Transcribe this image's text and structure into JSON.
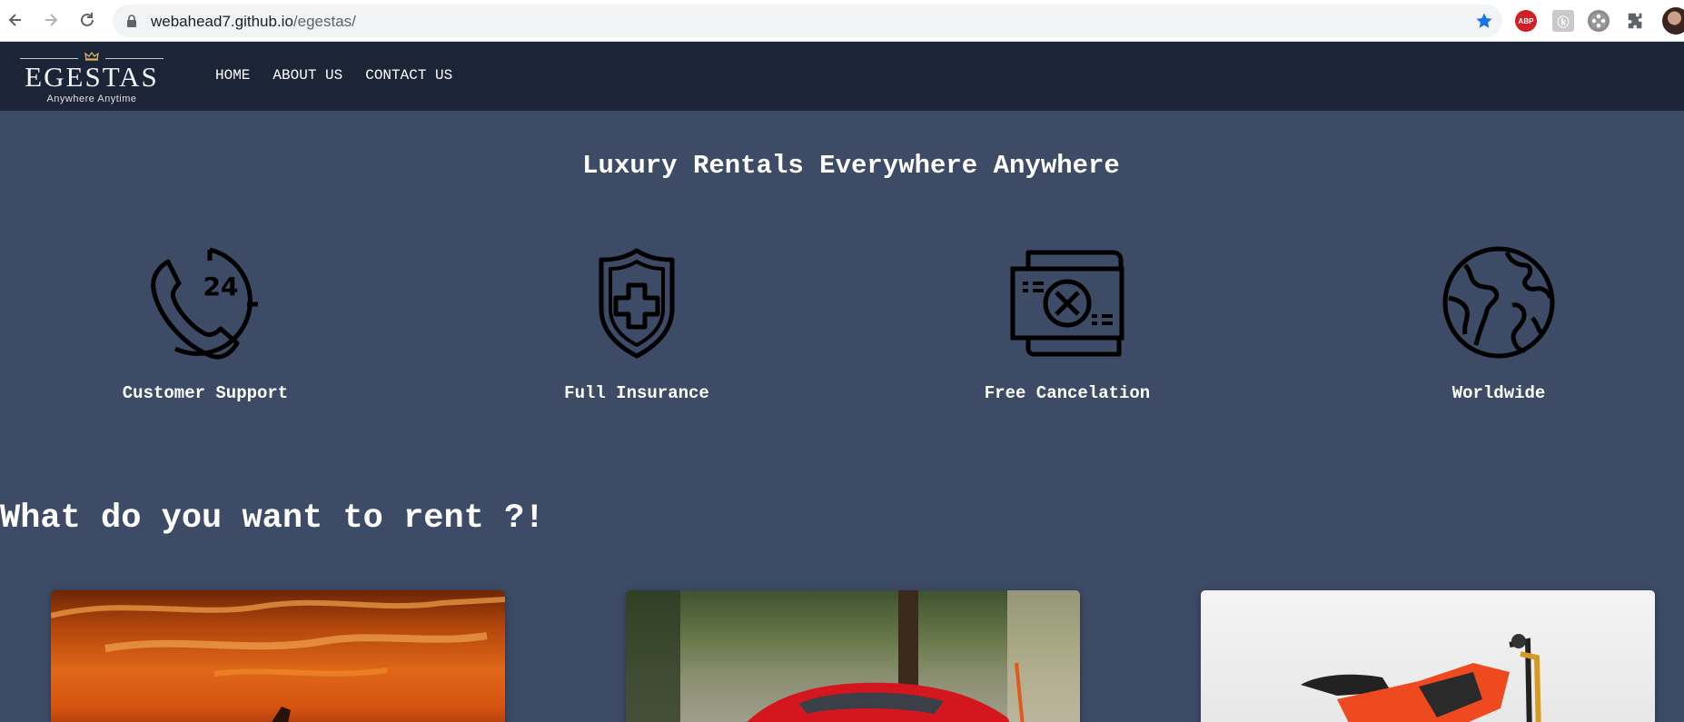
{
  "browser": {
    "url_domain": "webahead7.github.io",
    "url_path": "/egestas/",
    "extensions": [
      "adblock-plus-icon",
      "extension-icon",
      "film-reel-icon",
      "puzzle-icon"
    ],
    "abp_label": "ABP"
  },
  "header": {
    "logo_text": "EGESTAS",
    "logo_tagline": "Anywhere Anytime",
    "nav": [
      {
        "label": "HOME"
      },
      {
        "label": "ABOUT US"
      },
      {
        "label": "CONTACT US"
      }
    ]
  },
  "hero": {
    "title": "Luxury Rentals Everywhere Anywhere",
    "features": [
      {
        "label": "Customer Support",
        "icon": "phone-24-icon",
        "icon_text": "24"
      },
      {
        "label": "Full Insurance",
        "icon": "shield-cross-icon"
      },
      {
        "label": "Free Cancelation",
        "icon": "cancel-document-icon"
      },
      {
        "label": "Worldwide",
        "icon": "globe-icon"
      }
    ]
  },
  "rent": {
    "title": "What do you want to rent ?!",
    "cards": [
      {
        "image": "sunset-jet-ski-image"
      },
      {
        "image": "red-sports-car-image"
      },
      {
        "image": "orange-motorcycle-image"
      }
    ]
  },
  "colors": {
    "page_bg": "#3d4b66",
    "header_bg": "#1c2538",
    "text": "#ffffff"
  }
}
